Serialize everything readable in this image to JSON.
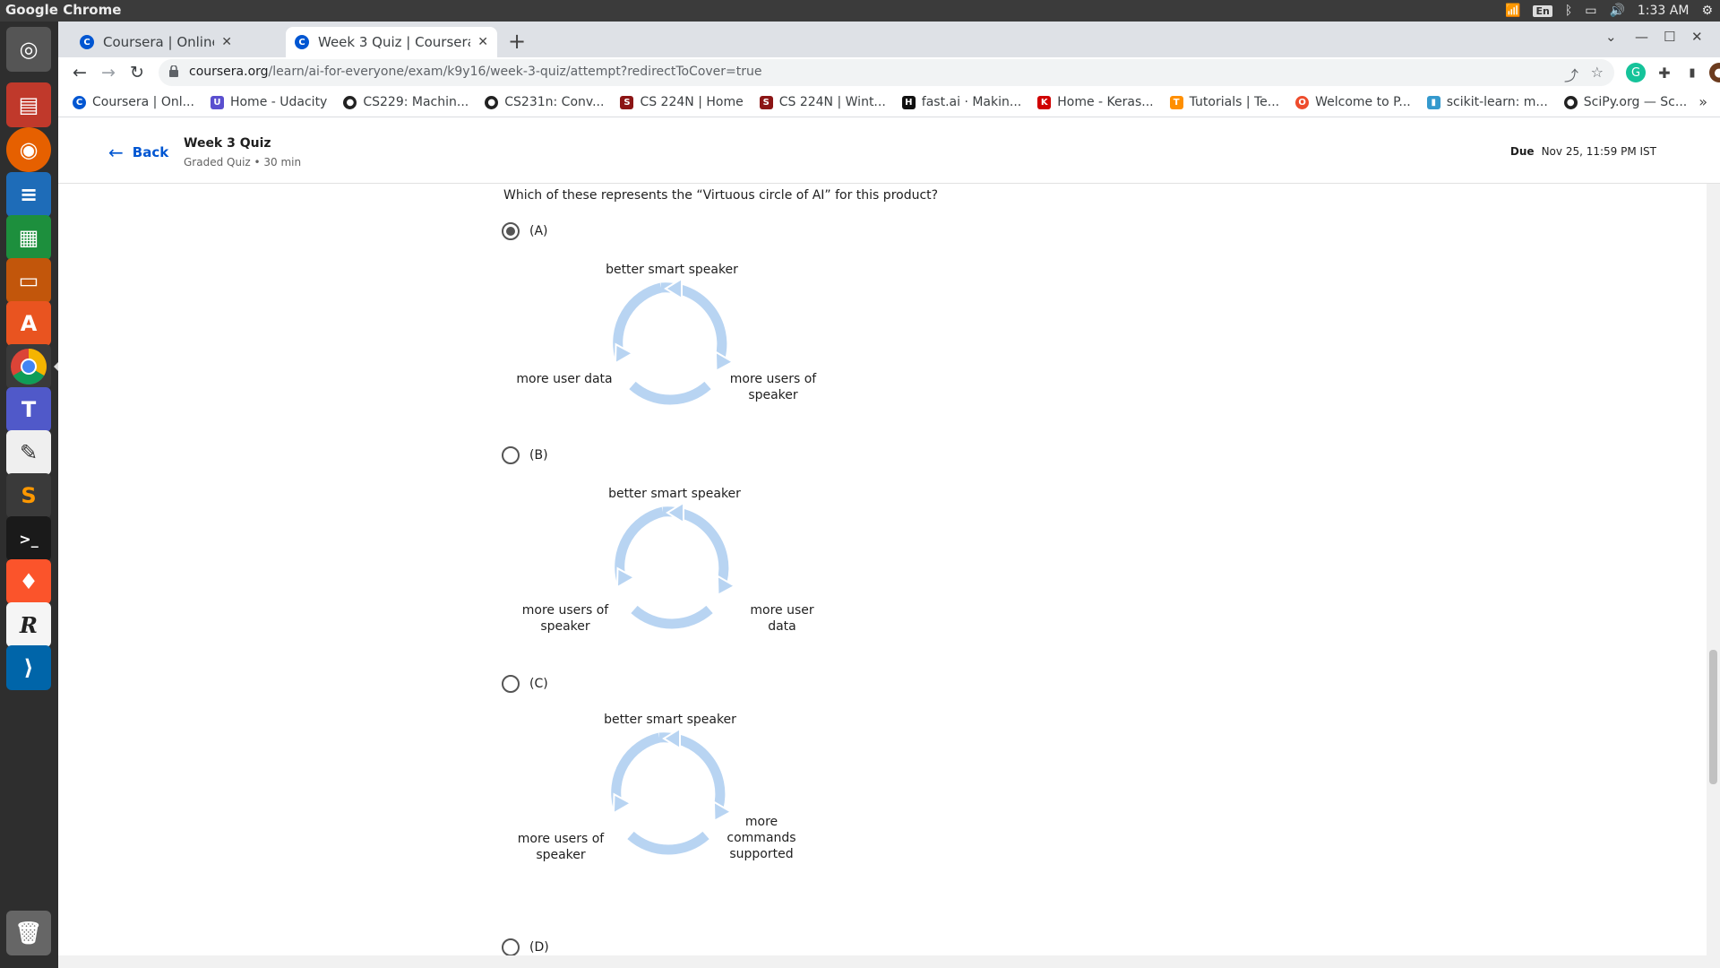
{
  "os": {
    "app_name": "Google Chrome",
    "lang": "En",
    "clock": "1:33 AM"
  },
  "tabs": [
    {
      "title": "Coursera | Online Courses",
      "active": false
    },
    {
      "title": "Week 3 Quiz | Coursera",
      "active": true
    }
  ],
  "url": {
    "domain": "coursera.org",
    "path": "/learn/ai-for-everyone/exam/k9y16/week-3-quiz/attempt?redirectToCover=true"
  },
  "bookmarks": [
    {
      "label": "Coursera | Onl...",
      "color": "#0056d2",
      "icon": "C"
    },
    {
      "label": "Home - Udacity",
      "color": "#5a4fcf",
      "icon": "U"
    },
    {
      "label": "CS229: Machin...",
      "color": "#222222",
      "icon": "●"
    },
    {
      "label": "CS231n: Conv...",
      "color": "#222222",
      "icon": "●"
    },
    {
      "label": "CS 224N | Home",
      "color": "#8c1515",
      "icon": "S"
    },
    {
      "label": "CS 224N | Wint...",
      "color": "#8c1515",
      "icon": "S"
    },
    {
      "label": "fast.ai · Makin...",
      "color": "#111111",
      "icon": "H"
    },
    {
      "label": "Home - Keras...",
      "color": "#d00000",
      "icon": "K"
    },
    {
      "label": "Tutorials  |  Te...",
      "color": "#ff8f00",
      "icon": "T"
    },
    {
      "label": "Welcome to P...",
      "color": "#ee4c2c",
      "icon": "O"
    },
    {
      "label": "scikit-learn: m...",
      "color": "#3499cd",
      "icon": "▮"
    },
    {
      "label": "SciPy.org — Sc...",
      "color": "#222222",
      "icon": "●"
    }
  ],
  "quiz": {
    "back_label": "Back",
    "title": "Week 3 Quiz",
    "meta": "Graded Quiz • 30 min",
    "due_label": "Due",
    "due_value": "Nov 25, 11:59 PM IST",
    "question": "Which of these represents the “Virtuous circle of AI” for this product?",
    "options": [
      {
        "label": "(A)",
        "selected": true,
        "top": "better smart speaker",
        "left": "more user data",
        "right": "more users of speaker"
      },
      {
        "label": "(B)",
        "selected": false,
        "top": "better smart speaker",
        "left": "more users of speaker",
        "right": "more user data"
      },
      {
        "label": "(C)",
        "selected": false,
        "top": "better smart speaker",
        "left": "more users of speaker",
        "right": "more commands supported"
      },
      {
        "label": "(D)",
        "selected": false
      }
    ]
  },
  "colors": {
    "cycle_arrow": "#b8d4f2",
    "link": "#0056d2"
  }
}
